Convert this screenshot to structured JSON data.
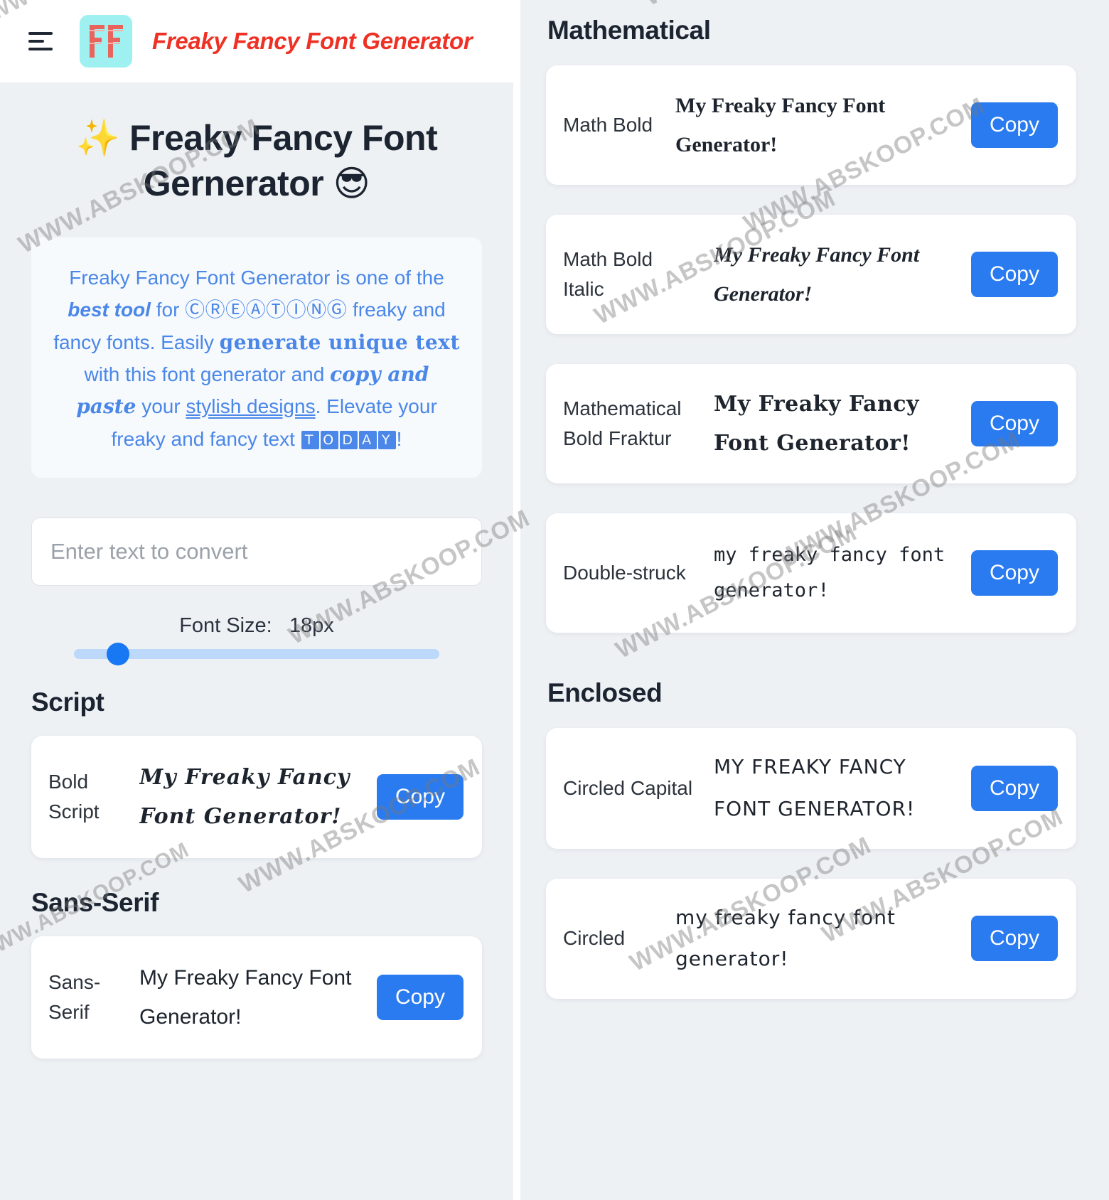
{
  "header": {
    "menu_icon": "hamburger-menu-icon",
    "logo_text": "FF",
    "logo_bg": "#9ff0f0",
    "brand_title": "Freaky Fancy Font Generator",
    "brand_color": "#ee3124"
  },
  "hero": {
    "title_prefix": "✨",
    "title": "Freaky Fancy Font Gernerator",
    "title_suffix": "😎"
  },
  "intro": {
    "p1": "Freaky Fancy Font Generator is one of the ",
    "bold1": "best tool",
    "p2": " for ",
    "circled1": "ⒸⓇⒺⒶⓉⒾⓃⒼ",
    "p3": " freaky and fancy fonts. Easily ",
    "fraktur1": "generate unique text",
    "p4": " with this font generator and ",
    "script1": "copy and paste",
    "p5": " your ",
    "dunder1": "stylish designs",
    "p6": ". Elevate your freaky and fancy text ",
    "squared1": "TODAY",
    "p7": "!",
    "text_color": "#4a87e8"
  },
  "input": {
    "placeholder": "Enter text to convert",
    "value": ""
  },
  "slider": {
    "label": "Font Size:",
    "value": "18px",
    "fill_color": "#bcd8fb",
    "thumb_color": "#1877f2",
    "percent": 12
  },
  "copy_label": "Copy",
  "sections": [
    {
      "heading": "Script",
      "column": "left",
      "cards": [
        {
          "label": "Bold Script",
          "style": "pv-script",
          "preview": "𝓜𝔂 𝓕𝓻𝓮𝓪𝓴𝔂 𝓕𝓪𝓷𝓬𝔂 𝓕𝓸𝓷𝓽 𝓖𝓮𝓷𝓮𝓻𝓪𝓽𝓸𝓻!",
          "preview_plain": "My Freaky Fancy Font Generator!"
        }
      ]
    },
    {
      "heading": "Sans-Serif",
      "column": "left",
      "cards": [
        {
          "label": "Sans-Serif",
          "style": "pv-sans",
          "preview": "My Freaky Fancy Font Generator!",
          "preview_plain": "My Freaky Fancy Font Generator!"
        }
      ]
    },
    {
      "heading": "Mathematical",
      "column": "right",
      "cards": [
        {
          "label": "Math Bold",
          "style": "pv-mbold",
          "preview": "My Freaky Fancy Font Generator!",
          "preview_plain": "My Freaky Fancy Font Generator!"
        },
        {
          "label": "Math Bold Italic",
          "style": "pv-mbitalic",
          "preview": "My Freaky Fancy Font Generator!",
          "preview_plain": "My Freaky Fancy Font Generator!"
        },
        {
          "label": "Mathematical Bold Fraktur",
          "style": "pv-fraktur",
          "preview": "𝕸𝖞 𝕱𝖗𝖊𝖆𝖐𝖞 𝕱𝖆𝖓𝖈𝖞 𝕱𝖔𝖓𝖙 𝕲𝖊𝖓𝖊𝖗𝖆𝖙𝖔𝖗!",
          "preview_plain": "My Freaky Fancy Font Generator!"
        },
        {
          "label": "Double-struck",
          "style": "pv-dstruck",
          "preview": "𝕞𝕪 𝕗𝕣𝕖𝕒𝕜𝕪 𝕗𝕒𝕟𝕔𝕪 𝕗𝕠𝕟𝕥 𝕘𝕖𝕟𝕖𝕣𝕒𝕥𝕠𝕣!",
          "preview_plain": "my freaky fancy font generator!"
        }
      ]
    },
    {
      "heading": "Enclosed",
      "column": "right",
      "cards": [
        {
          "label": "Circled Capital",
          "style": "pv-circled",
          "preview": "ⓂⓎ ⒻⓇⒺⒶⓀⓎ ⒻⒶⓃⒸⓎ ⒻⓄⓃⓉ ⒼⒺⓃⒺⓇⒶⓉⓄⓇ!",
          "preview_plain": "MY FREAKY FANCY FONT GENERATOR!"
        },
        {
          "label": "Circled",
          "style": "pv-circled",
          "preview": "ⓜⓨ ⓕⓡⓔⓐⓚⓨ ⓕⓐⓝⓒⓨ ⓕⓞⓝⓣ ⓖⓔⓝⓔⓡⓐⓣⓞⓡ!",
          "preview_plain": "my freaky fancy font generator!"
        }
      ]
    }
  ],
  "watermark": {
    "text": "WWW.ABSKOOP.COM"
  }
}
